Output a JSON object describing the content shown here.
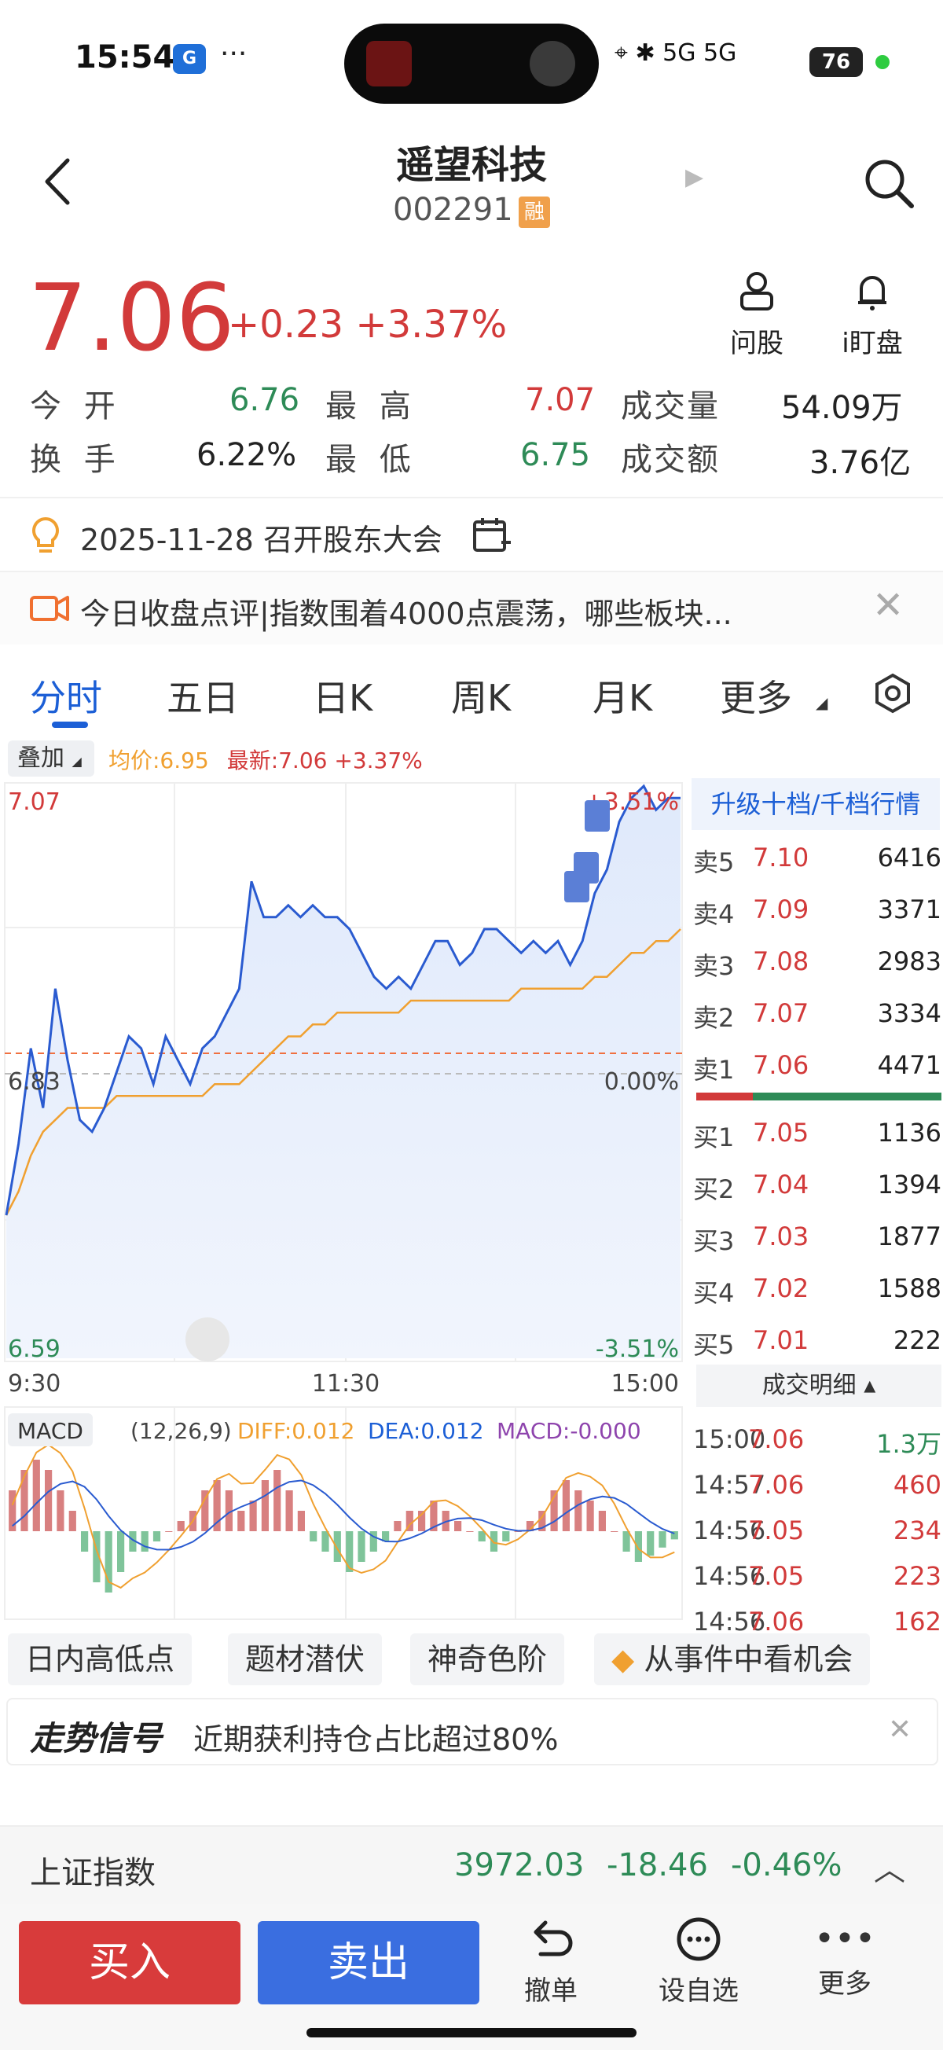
{
  "status_bar": {
    "time": "15:54",
    "app_icon_text": "G",
    "more": "···",
    "battery": "76",
    "network": "5G 5G"
  },
  "header": {
    "stock_name": "遥望科技",
    "stock_code": "002291",
    "margin_badge": "融"
  },
  "quote": {
    "price": "7.06",
    "change": "+0.23 +3.37%",
    "open_label": "今 开",
    "open": "6.76",
    "high_label": "最 高",
    "high": "7.07",
    "volume_label": "成交量",
    "volume": "54.09万",
    "turnover_label": "换 手",
    "turnover": "6.22%",
    "low_label": "最 低",
    "low": "6.75",
    "amount_label": "成交额",
    "amount": "3.76亿"
  },
  "tools": {
    "ask_stock": "问股",
    "watch_disk": "i盯盘"
  },
  "event": "2025-11-28 召开股东大会",
  "news": "今日收盘点评|指数围着4000点震荡，哪些板块...",
  "tabs": [
    "分时",
    "五日",
    "日K",
    "周K",
    "月K",
    "更多"
  ],
  "chart": {
    "overlay": "叠加",
    "avg_label": "均价:6.95",
    "latest_label": "最新:7.06 +3.37%",
    "y_top": "7.07",
    "y_mid": "6.83",
    "y_bot": "6.59",
    "pct_top": "+3.51%",
    "pct_mid": "0.00%",
    "pct_bot": "-3.51%",
    "x_start": "9:30",
    "x_mid": "11:30",
    "x_end": "15:00",
    "macd_label": "MACD",
    "macd_params": "(12,26,9)",
    "diff": "DIFF:0.012",
    "dea": "DEA:0.012",
    "macd": "MACD:-0.000"
  },
  "chart_data": {
    "type": "line",
    "title": "",
    "xlabel": "",
    "ylabel": "",
    "x_ticks": [
      "9:30",
      "11:30",
      "15:00"
    ],
    "ylim": [
      6.59,
      7.07
    ],
    "prev_close": 6.83,
    "series": [
      {
        "values": [
          6.71,
          6.77,
          6.85,
          6.8,
          6.9,
          6.84,
          6.79,
          6.78,
          6.8,
          6.83,
          6.86,
          6.85,
          6.82,
          6.86,
          6.84,
          6.82,
          6.85,
          6.86,
          6.88,
          6.9,
          6.99,
          6.96,
          6.96,
          6.97,
          6.96,
          6.97,
          6.96,
          6.96,
          6.95,
          6.93,
          6.91,
          6.9,
          6.91,
          6.9,
          6.92,
          6.94,
          6.94,
          6.92,
          6.93,
          6.95,
          6.95,
          6.94,
          6.93,
          6.94,
          6.93,
          6.94,
          6.92,
          6.94,
          6.98,
          7.0,
          7.04,
          7.06,
          7.07,
          7.05,
          7.06,
          7.06
        ]
      },
      {
        "name": "均价",
        "values": [
          6.71,
          6.73,
          6.76,
          6.78,
          6.79,
          6.8,
          6.8,
          6.8,
          6.8,
          6.81,
          6.81,
          6.81,
          6.81,
          6.81,
          6.81,
          6.81,
          6.81,
          6.82,
          6.82,
          6.82,
          6.83,
          6.84,
          6.85,
          6.86,
          6.86,
          6.87,
          6.87,
          6.88,
          6.88,
          6.88,
          6.88,
          6.88,
          6.88,
          6.89,
          6.89,
          6.89,
          6.89,
          6.89,
          6.89,
          6.89,
          6.89,
          6.89,
          6.9,
          6.9,
          6.9,
          6.9,
          6.9,
          6.9,
          6.91,
          6.91,
          6.92,
          6.93,
          6.93,
          6.94,
          6.94,
          6.95
        ]
      }
    ],
    "macd_bars": [
      0.02,
      0.03,
      0.035,
      0.03,
      0.02,
      0.01,
      -0.01,
      -0.025,
      -0.03,
      -0.02,
      -0.01,
      -0.01,
      -0.005,
      0.0,
      0.005,
      0.01,
      0.02,
      0.025,
      0.02,
      0.01,
      0.015,
      0.025,
      0.03,
      0.02,
      0.01,
      -0.005,
      -0.01,
      -0.015,
      -0.02,
      -0.015,
      -0.01,
      -0.005,
      0.005,
      0.01,
      0.01,
      0.015,
      0.01,
      0.005,
      0.0,
      -0.005,
      -0.01,
      -0.005,
      0.0,
      0.005,
      0.01,
      0.02,
      0.025,
      0.02,
      0.015,
      0.01,
      0.0,
      -0.01,
      -0.015,
      -0.012,
      -0.008,
      -0.004
    ]
  },
  "orderbook": {
    "header": "升级十档/千档行情",
    "asks": [
      {
        "label": "卖5",
        "price": "7.10",
        "vol": "6416"
      },
      {
        "label": "卖4",
        "price": "7.09",
        "vol": "3371"
      },
      {
        "label": "卖3",
        "price": "7.08",
        "vol": "2983"
      },
      {
        "label": "卖2",
        "price": "7.07",
        "vol": "3334"
      },
      {
        "label": "卖1",
        "price": "7.06",
        "vol": "4471"
      }
    ],
    "bids": [
      {
        "label": "买1",
        "price": "7.05",
        "vol": "1136"
      },
      {
        "label": "买2",
        "price": "7.04",
        "vol": "1394"
      },
      {
        "label": "买3",
        "price": "7.03",
        "vol": "1877"
      },
      {
        "label": "买4",
        "price": "7.02",
        "vol": "1588"
      },
      {
        "label": "买5",
        "price": "7.01",
        "vol": "222"
      }
    ],
    "trades_header": "成交明细",
    "trades": [
      {
        "time": "15:00",
        "price": "7.06",
        "vol": "1.3万"
      },
      {
        "time": "14:57",
        "price": "7.06",
        "vol": "460"
      },
      {
        "time": "14:56",
        "price": "7.05",
        "vol": "234"
      },
      {
        "time": "14:56",
        "price": "7.05",
        "vol": "223"
      },
      {
        "time": "14:56",
        "price": "7.06",
        "vol": "162"
      }
    ]
  },
  "feature_tags": [
    "日内高低点",
    "题材潜伏",
    "神奇色阶",
    "从事件中看机会"
  ],
  "signal": {
    "title": "走势信号",
    "text": "近期获利持仓占比超过80%"
  },
  "index": {
    "name": "上证指数",
    "value": "3972.03",
    "change": "-18.46",
    "pct": "-0.46%"
  },
  "bottom": {
    "buy": "买入",
    "sell": "卖出",
    "cancel": "撤单",
    "add_watch": "设自选",
    "more": "更多"
  },
  "colors": {
    "up": "#d23a3a",
    "down": "#2e8b57",
    "accent": "#1c5fd6",
    "avg_line": "#f0a030"
  }
}
